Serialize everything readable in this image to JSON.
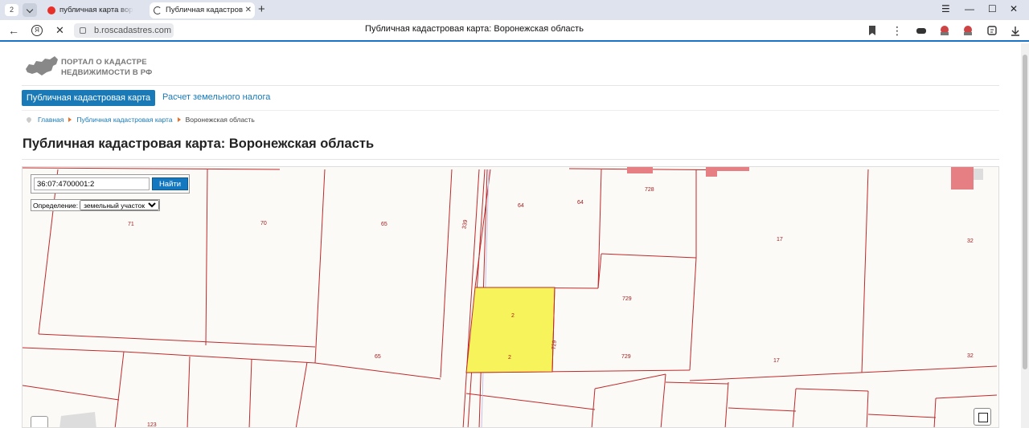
{
  "browser": {
    "tab_count": "2",
    "tabs": [
      {
        "title": "публичная карта воронеж",
        "active": false
      },
      {
        "title": "Публичная кадастров",
        "active": true
      }
    ],
    "url": "b.roscadastres.com",
    "page_title": "Публичная кадастровая карта: Воронежская область"
  },
  "site": {
    "logo_line1": "ПОРТАЛ О КАДАСТРЕ",
    "logo_line2": "НЕДВИЖИМОСТИ В РФ",
    "nav": {
      "active": "Публичная кадастровая карта",
      "link": "Расчет земельного налога"
    },
    "breadcrumb": [
      "Главная",
      "Публичная кадастровая карта",
      "Воронежская область"
    ],
    "heading": "Публичная кадастровая карта: Воронежская область"
  },
  "map": {
    "search_value": "36:07:4700001:2",
    "search_button": "Найти",
    "definition_label": "Определение:",
    "definition_value": "земельный участок",
    "parcel_labels": [
      "71",
      "70",
      "65",
      "339",
      "64",
      "64",
      "728",
      "17",
      "32",
      "2",
      "2",
      "729",
      "729",
      "729",
      "65",
      "17",
      "32",
      "123"
    ],
    "colors": {
      "boundary": "#c0282a",
      "highlight": "#f7f35a",
      "background": "#fbfaf6"
    }
  }
}
